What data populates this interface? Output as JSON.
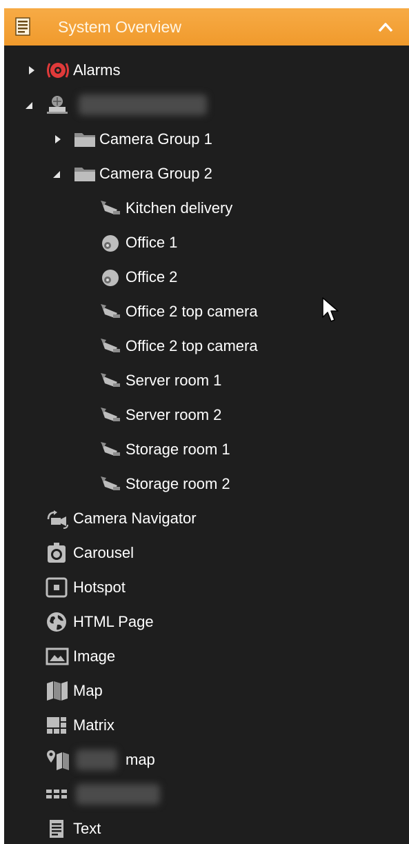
{
  "panel": {
    "title": "System Overview",
    "header_color": "#f3a23a",
    "background_color": "#1e1e1e"
  },
  "tree": {
    "alarms": "Alarms",
    "camera_group_1": "Camera Group 1",
    "camera_group_2": "Camera Group 2",
    "cameras": [
      "Kitchen delivery",
      "Office 1",
      "Office 2",
      "Office 2 top camera",
      "Office 2 top camera",
      "Server room 1",
      "Server room 2",
      "Storage room 1",
      "Storage room 2"
    ],
    "view_items": [
      "Camera Navigator",
      "Carousel",
      "Hotspot",
      "HTML Page",
      "Image",
      "Map",
      "Matrix",
      "map",
      "Text"
    ]
  },
  "icons": {
    "panel": "document-icon",
    "collapse": "chevron-up-icon",
    "alarms": "alarm-icon",
    "server": "server-icon",
    "folder": "folder-icon",
    "camera": "camera-icon",
    "dome": "dome-camera-icon"
  }
}
